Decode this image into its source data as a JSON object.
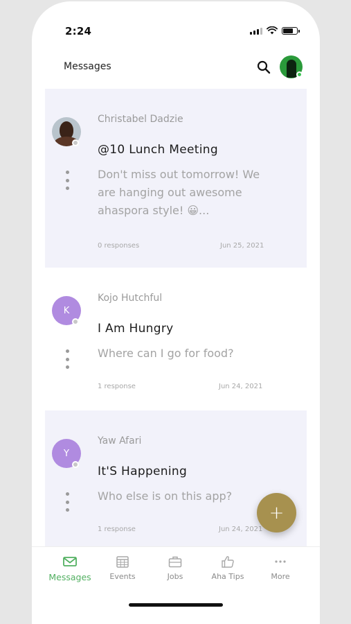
{
  "status_bar": {
    "time": "2:24"
  },
  "header": {
    "title": "Messages"
  },
  "messages": [
    {
      "sender": "Christabel Dadzie",
      "avatar_initial": "",
      "subject": "@10 Lunch Meeting",
      "preview_lines": [
        "Don't miss out tomorrow! We",
        "are hanging out awesome",
        "ahaspora style! 😀..."
      ],
      "responses": "0 responses",
      "date": "Jun 25, 2021"
    },
    {
      "sender": "Kojo Hutchful",
      "avatar_initial": "K",
      "subject": "I Am Hungry",
      "preview_lines": [
        "Where can I go for food?"
      ],
      "responses": "1 response",
      "date": "Jun 24, 2021"
    },
    {
      "sender": "Yaw Afari",
      "avatar_initial": "Y",
      "subject": "It'S Happening",
      "preview_lines": [
        "Who else is on this app?"
      ],
      "responses": "1 response",
      "date": "Jun 24, 2021"
    }
  ],
  "fab": {
    "icon": "plus-icon",
    "symbol": "+"
  },
  "bottom_nav": [
    {
      "label": "Messages",
      "icon": "mail-icon",
      "active": true
    },
    {
      "label": "Events",
      "icon": "calendar-icon",
      "active": false
    },
    {
      "label": "Jobs",
      "icon": "briefcase-icon",
      "active": false
    },
    {
      "label": "Aha Tips",
      "icon": "thumbs-up-icon",
      "active": false
    },
    {
      "label": "More",
      "icon": "more-dots-icon",
      "active": false
    }
  ],
  "colors": {
    "accent_green": "#52b061",
    "fab_gold": "#a7914f",
    "avatar_purple": "#b08be0",
    "card_shade": "#f2f2fa"
  }
}
